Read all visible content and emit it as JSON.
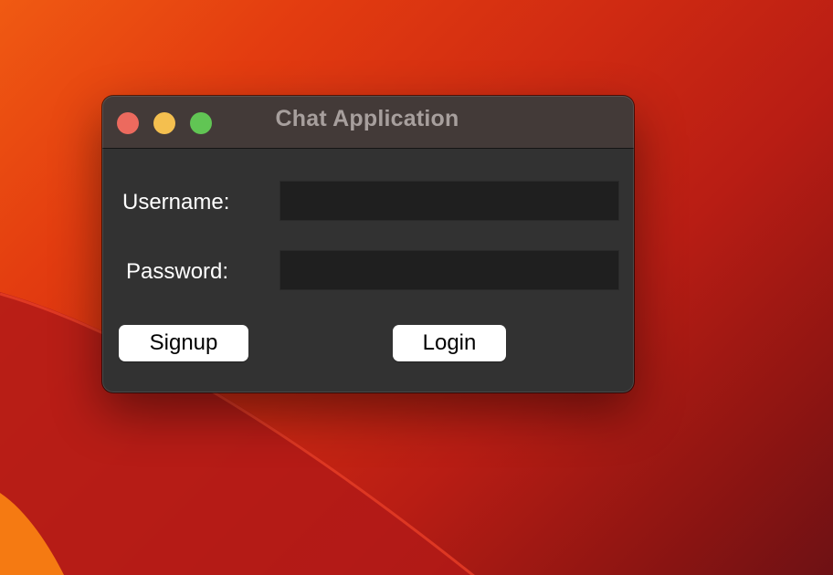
{
  "window": {
    "title": "Chat Application"
  },
  "form": {
    "username_label": "Username:",
    "username_value": "",
    "password_label": "Password:",
    "password_value": ""
  },
  "buttons": {
    "signup_label": "Signup",
    "login_label": "Login"
  },
  "colors": {
    "close": "#ec6a5e",
    "minimize": "#f4bf4f",
    "zoom": "#61c554",
    "window_bg": "#323232",
    "titlebar_bg": "#433a38",
    "input_bg": "#1f1f1f"
  }
}
